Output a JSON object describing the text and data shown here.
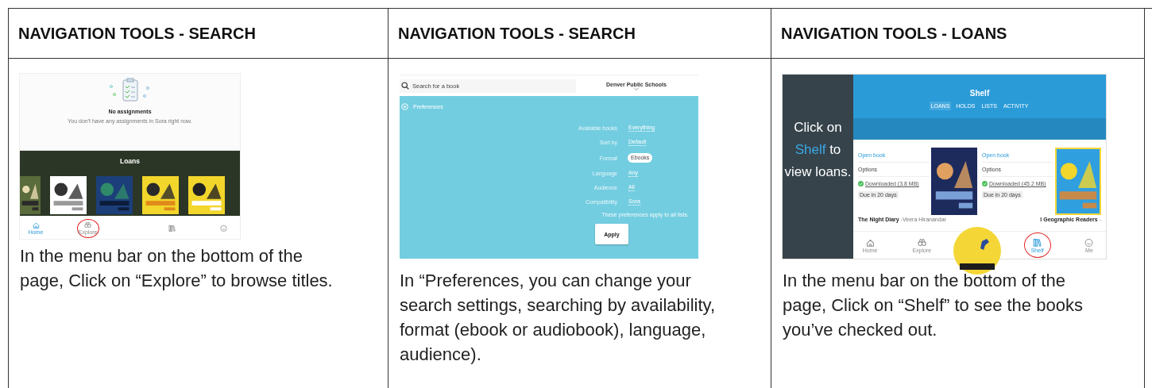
{
  "columns": [
    {
      "header": "NAVIGATION TOOLS - SEARCH",
      "screen": {
        "kind": "assignments",
        "empty_title": "No assignments",
        "empty_text": "You don't have any assignments in Sora right now.",
        "band_title": "Loans",
        "nav": [
          {
            "kind": "home",
            "label": "Home",
            "selected": true,
            "circled": false
          },
          {
            "kind": "binoculars",
            "label": "Explore",
            "selected": false,
            "circled": true
          },
          {
            "kind": "shelf",
            "selected": false,
            "circled": false
          },
          {
            "kind": "face",
            "selected": false,
            "circled": false
          }
        ]
      },
      "caption": "In the menu bar on the bottom of the page, Click on “Explore” to browse titles."
    },
    {
      "header": "NAVIGATION TOOLS - SEARCH",
      "screen": {
        "kind": "preferences",
        "search": {
          "placeholder": "Search for a book"
        },
        "library": "Denver Public Schools",
        "section": "Preferences",
        "rows": [
          {
            "label": "Available books",
            "value": "Everything",
            "selected": false
          },
          {
            "label": "Sort by",
            "value": "Default",
            "selected": false
          },
          {
            "label": "Format",
            "value": "Ebooks",
            "selected": true
          },
          {
            "label": "Language",
            "value": "Any",
            "selected": false
          },
          {
            "label": "Audience",
            "value": "All",
            "selected": false
          },
          {
            "label": "Compatibility",
            "value": "Sora",
            "selected": false
          }
        ],
        "note": "These preferences apply to all lists.",
        "apply": "Apply"
      },
      "caption": "In “Preferences, you can change your search settings, searching by availability, format (ebook or audiobook), language, audience)."
    },
    {
      "header": "NAVIGATION TOOLS - LOANS",
      "screen": {
        "kind": "shelf",
        "callout": {
          "before": "Click on",
          "highlight": "Shelf",
          "after": "to view loans."
        },
        "title": "Shelf",
        "tabs": [
          {
            "label": "LOANS",
            "selected": true
          },
          {
            "label": "HOLDS",
            "selected": false
          },
          {
            "label": "LISTS",
            "selected": false
          },
          {
            "label": "ACTIVITY",
            "selected": false
          }
        ],
        "loans": [
          {
            "open": "Open book",
            "options": "Options",
            "status": "Downloaded (3.8 MB)",
            "due": "Due in 20 days",
            "title": "**The Night Diary** -Veera Hiranandar"
          },
          {
            "open": "Open book",
            "options": "Options",
            "status": "Downloaded (45.2 MB)",
            "due": "Due in 20 days",
            "title": "**l Geographic Readers** -"
          }
        ],
        "nav": [
          {
            "kind": "home",
            "label": "Home",
            "selected": false,
            "circled": false
          },
          {
            "kind": "binoculars",
            "label": "Explore",
            "selected": false,
            "circled": false
          },
          {
            "kind": "shelf",
            "label": "Shelf",
            "selected": true,
            "circled": true
          },
          {
            "kind": "face",
            "label": "Me",
            "selected": false,
            "circled": false
          }
        ]
      },
      "caption": "In the menu bar on the bottom of the page, Click on “Shelf” to see the books you’ve checked out."
    }
  ]
}
